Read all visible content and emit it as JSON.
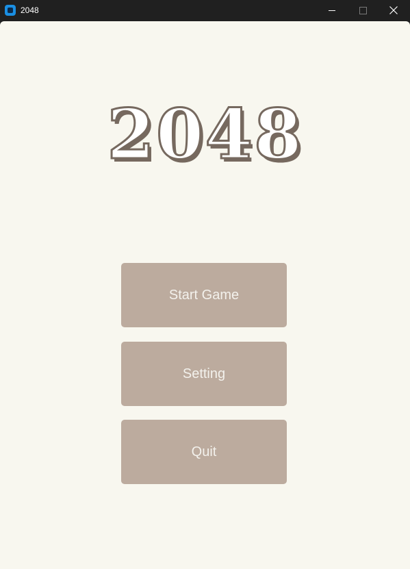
{
  "window": {
    "title": "2048",
    "controls": {
      "minimize": "minimize-icon",
      "maximize": "maximize-icon",
      "close": "close-icon"
    }
  },
  "main": {
    "logo_text": "2048",
    "buttons": {
      "start": "Start Game",
      "setting": "Setting",
      "quit": "Quit"
    }
  },
  "colors": {
    "background": "#f8f7ef",
    "button": "#bcab9e",
    "button_text": "#f3f1ec",
    "logo_outline": "#76695f",
    "titlebar": "#202020",
    "app_icon": "#1a8fe3"
  }
}
